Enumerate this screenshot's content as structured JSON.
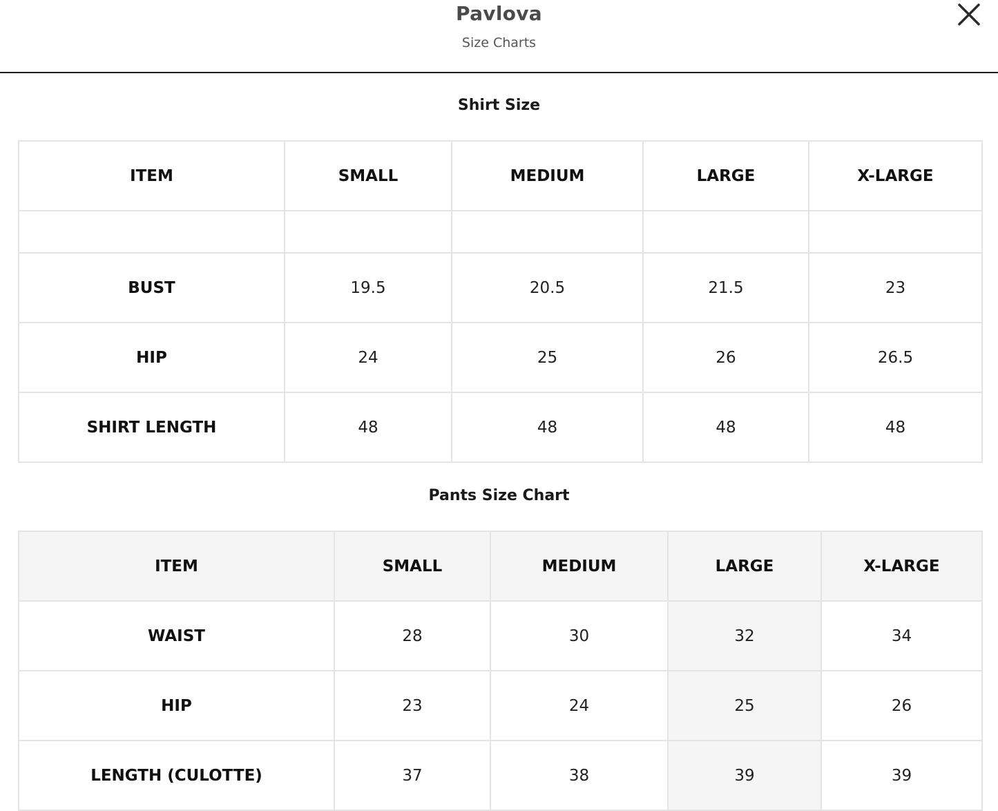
{
  "header": {
    "brand": "Pavlova",
    "subtitle": "Size Charts",
    "close_icon": "close-icon"
  },
  "shirt": {
    "title": "Shirt Size",
    "columns": [
      "ITEM",
      "SMALL",
      "MEDIUM",
      "LARGE",
      "X-LARGE"
    ],
    "rows": [
      {
        "label": "BUST",
        "values": [
          "19.5",
          "20.5",
          "21.5",
          "23"
        ]
      },
      {
        "label": "HIP",
        "values": [
          "24",
          "25",
          "26",
          "26.5"
        ]
      },
      {
        "label": "SHIRT LENGTH",
        "values": [
          "48",
          "48",
          "48",
          "48"
        ]
      }
    ]
  },
  "pants": {
    "title": "Pants Size Chart",
    "columns": [
      "ITEM",
      "SMALL",
      "MEDIUM",
      "LARGE",
      "X-LARGE"
    ],
    "rows": [
      {
        "label": "WAIST",
        "values": [
          "28",
          "30",
          "32",
          "34"
        ]
      },
      {
        "label": "HIP",
        "values": [
          "23",
          "24",
          "25",
          "26"
        ]
      },
      {
        "label": "LENGTH (CULOTTE)",
        "values": [
          "37",
          "38",
          "39",
          "39"
        ]
      }
    ]
  },
  "colors": {
    "header_rule": "#1a1a1a",
    "cell_border": "#e4e4e4",
    "highlight_bg": "#f5f5f5"
  }
}
